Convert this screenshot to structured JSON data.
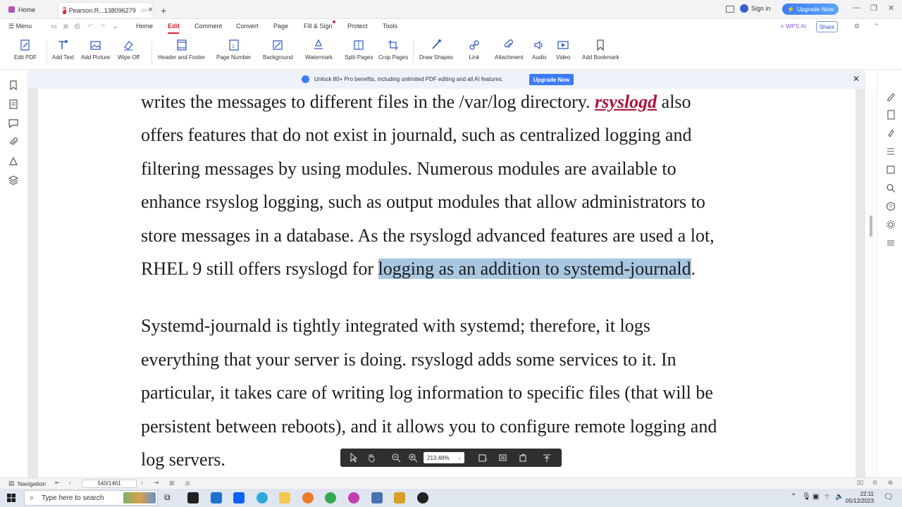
{
  "tabs": {
    "home": "Home",
    "doc": "Pearson.R...138096279"
  },
  "header": {
    "sign_in": "Sign in",
    "upgrade_now": "Upgrade Now"
  },
  "menu": {
    "menu_label": "Menu",
    "items": [
      "Home",
      "Edit",
      "Comment",
      "Convert",
      "Page",
      "Fill & Sign",
      "Protect",
      "Tools"
    ],
    "active": "Edit",
    "wps_ai": "WPS AI",
    "share": "Share"
  },
  "toolbar": {
    "tools": [
      "Edit PDF",
      "Add Text",
      "Add Picture",
      "Wipe Off",
      "Header and Footer",
      "Page Number",
      "Background",
      "Watermark",
      "Split Pages",
      "Crop Pages",
      "Draw Shapes",
      "Link",
      "Attachment",
      "Audio",
      "Video",
      "Add Bookmark"
    ]
  },
  "banner": {
    "text": "Unlock 80+ Pro benefits, including unlimited PDF editing and all AI features.",
    "button": "Upgrade Now"
  },
  "document": {
    "lines": [
      {
        "pre": "writes the messages to different files in the /var/log directory. ",
        "link": "rsyslogd",
        "post": " also"
      },
      {
        "text": "offers features that do not exist in journald, such as centralized logging and"
      },
      {
        "text": "filtering messages by using modules. Numerous modules are available to"
      },
      {
        "text": "enhance rsyslog logging, such as output modules that allow administrators to"
      },
      {
        "text": "store messages in a database. As the rsyslogd advanced features are used a lot,"
      },
      {
        "pre": "RHEL 9 still offers rsyslogd for ",
        "highlight": "logging as an addition to systemd-journald",
        "post": "."
      },
      {
        "text": "Systemd-journald is tightly integrated with systemd; therefore, it logs"
      },
      {
        "text": "everything that your server is doing. rsyslogd adds some services to it. In"
      },
      {
        "text": "particular, it takes care of writing log information to specific files (that will be"
      },
      {
        "text": "persistent between reboots), and it allows you to configure remote logging and"
      },
      {
        "text": "log servers."
      }
    ]
  },
  "zoom": {
    "level": "213.48%"
  },
  "status": {
    "navigation": "Navigation",
    "page": "540/1461"
  },
  "taskbar": {
    "search_placeholder": "Type here to search",
    "time": "22:11",
    "date": "05/12/2023"
  },
  "colors": {
    "accent_red": "#d7263d",
    "highlight": "#a9c7e0",
    "link": "#b0123a",
    "upgrade_blue": "#3c7cf4"
  }
}
